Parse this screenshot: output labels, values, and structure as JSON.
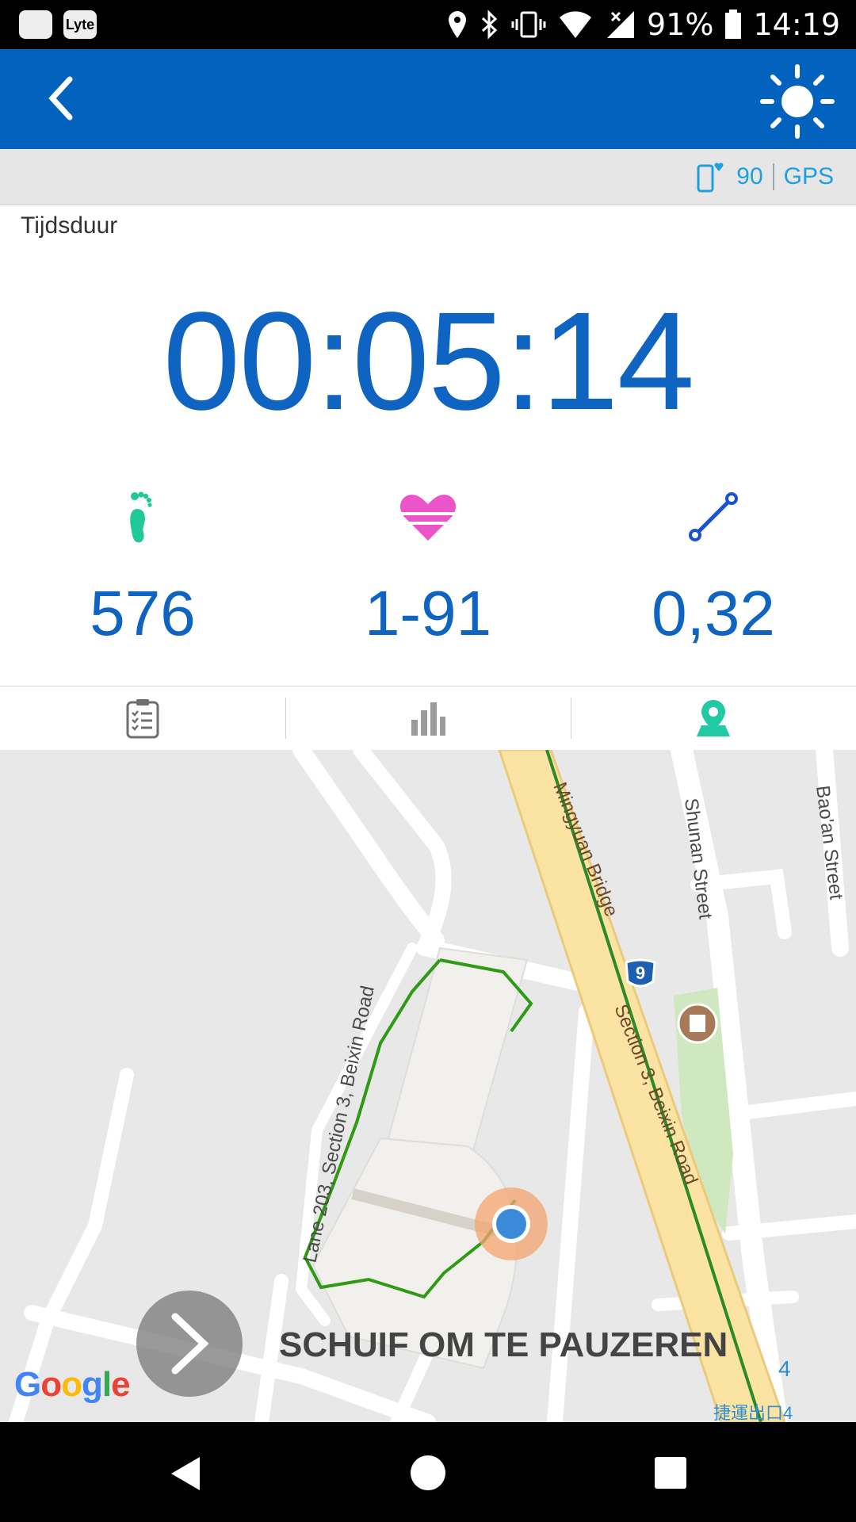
{
  "status_bar": {
    "battery_percent": "91%",
    "time": "14:19",
    "left_icons": [
      "message-icon",
      "lyte-app-icon"
    ],
    "app_label": "Lyte",
    "right_icons": [
      "location-icon",
      "bluetooth-icon",
      "vibrate-icon",
      "wifi-icon",
      "signal-icon",
      "battery-icon"
    ]
  },
  "app_bar": {
    "back_icon": "chevron-left-icon",
    "brightness_icon": "sun-icon",
    "color": "#0362be"
  },
  "info_bar": {
    "heart_rate": "90",
    "gps_label": "GPS"
  },
  "duration": {
    "label": "Tijdsduur",
    "value": "00:05:14"
  },
  "stats": [
    {
      "icon": "footprint-icon",
      "value": "576"
    },
    {
      "icon": "heart-icon",
      "value": "1-91"
    },
    {
      "icon": "distance-icon",
      "value": "0,32"
    }
  ],
  "tabs": [
    {
      "icon": "clipboard-list-icon",
      "active": false
    },
    {
      "icon": "bar-chart-icon",
      "active": false
    },
    {
      "icon": "map-pin-icon",
      "active": true
    }
  ],
  "map": {
    "streets": [
      "Mingyuan Bridge",
      "Section 3, Beixin Road",
      "Lane 203, Section 3, Beixin Road",
      "Shunan Street",
      "Bao'an Street"
    ],
    "route_marker": "9",
    "exit_label": "捷運出口4",
    "exit_number": "4",
    "slide_label": "SCHUIF OM TE PAUZEREN",
    "google_logo": "Google"
  }
}
